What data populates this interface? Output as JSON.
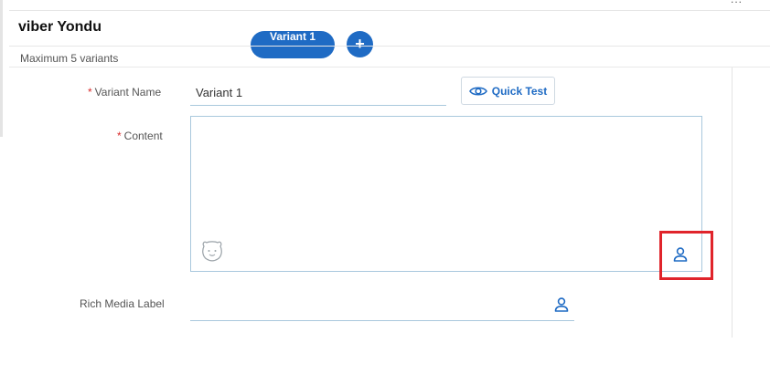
{
  "header": {
    "title": "viber Yondu",
    "more_glyph": "..."
  },
  "variants": {
    "active_tab": "Variant 1",
    "add_glyph": "+",
    "max_note": "Maximum 5 variants"
  },
  "form": {
    "required_mark": "*",
    "variant_name_label": "Variant Name",
    "variant_name_value": "Variant 1",
    "content_label": "Content",
    "rich_media_label": "Rich Media Label",
    "quick_test_label": "Quick Test"
  },
  "icons": {
    "eye": "eye-icon",
    "emoji": "emoji-icon",
    "person": "person-icon"
  },
  "colors": {
    "accent": "#1f6bc4",
    "required": "#d92b2b",
    "highlight": "#e0242b"
  }
}
